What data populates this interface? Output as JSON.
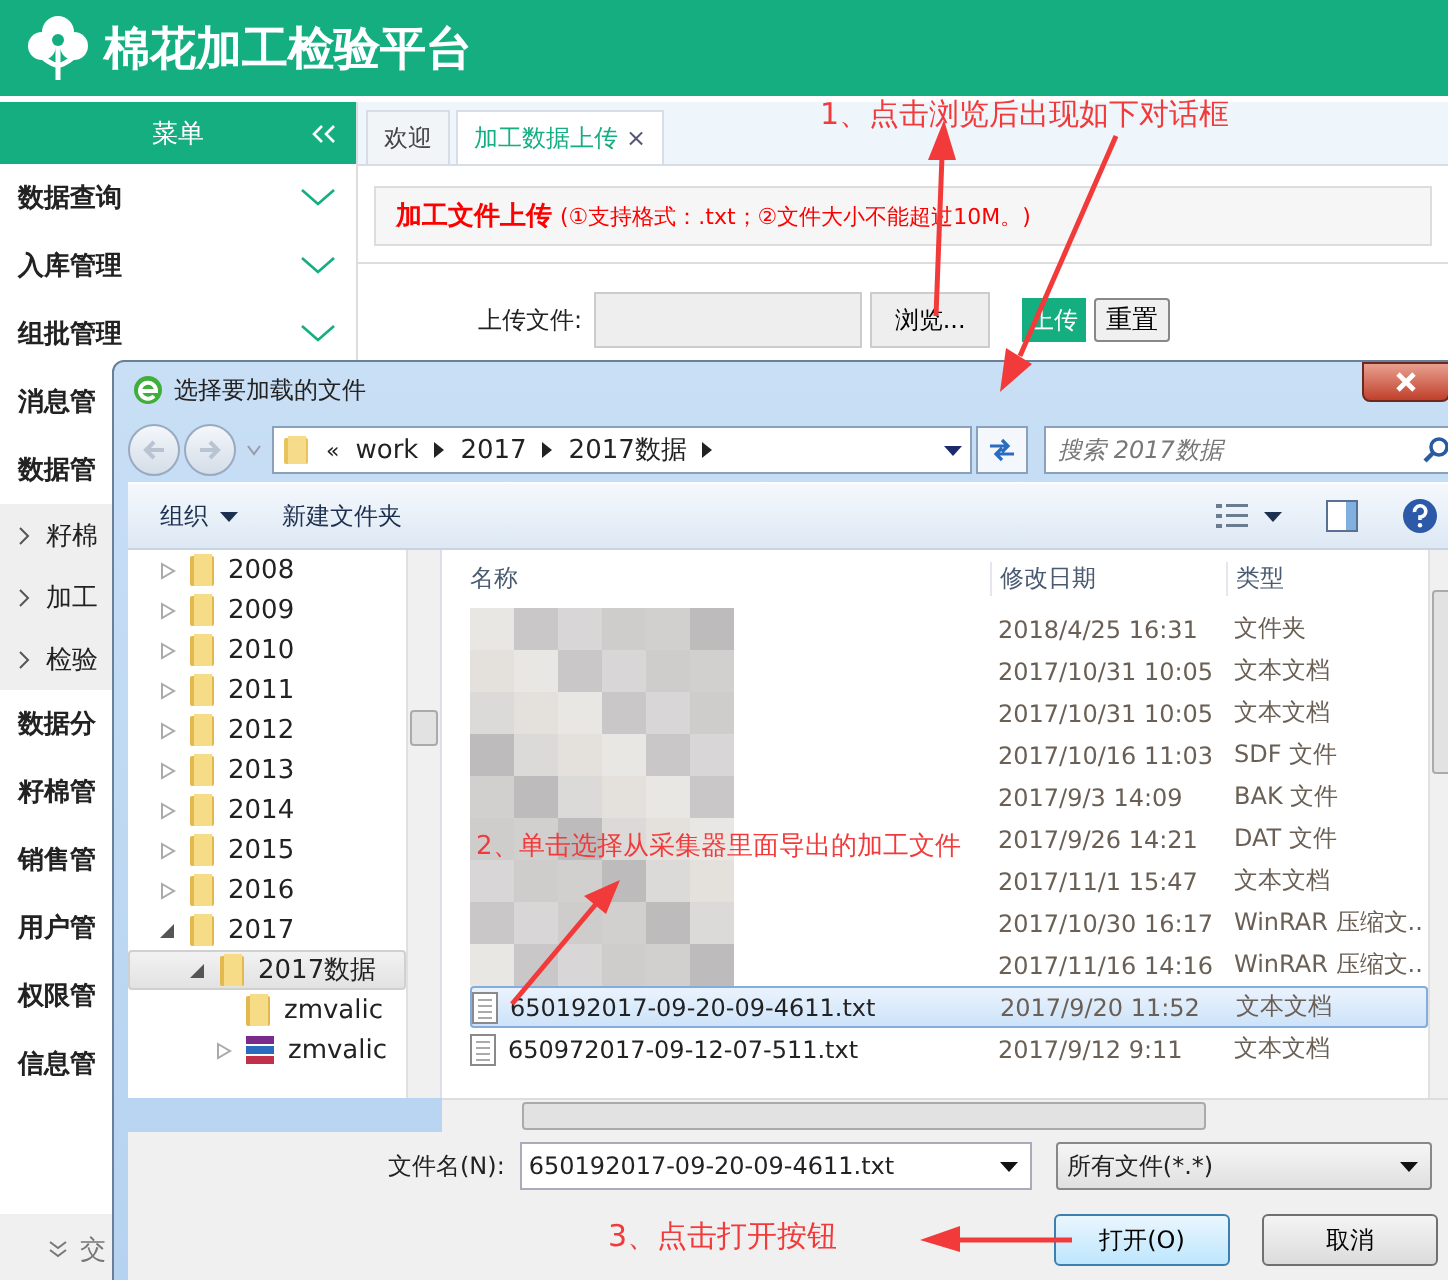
{
  "app": {
    "title": "棉花加工检验平台"
  },
  "sidebar": {
    "title": "菜单",
    "items": [
      {
        "label": "数据查询",
        "kind": "group",
        "chevron": true
      },
      {
        "label": "入库管理",
        "kind": "group",
        "chevron": true
      },
      {
        "label": "组批管理",
        "kind": "group",
        "chevron": true
      },
      {
        "label": "消息管",
        "kind": "group",
        "chevron": false
      },
      {
        "label": "数据管",
        "kind": "group",
        "chevron": false
      },
      {
        "label": "籽棉",
        "kind": "sub",
        "chevron": false
      },
      {
        "label": "加工",
        "kind": "sub",
        "chevron": false
      },
      {
        "label": "检验",
        "kind": "sub",
        "chevron": false
      },
      {
        "label": "数据分",
        "kind": "group",
        "chevron": false
      },
      {
        "label": "籽棉管",
        "kind": "group",
        "chevron": false
      },
      {
        "label": "销售管",
        "kind": "group",
        "chevron": false
      },
      {
        "label": "用户管",
        "kind": "group",
        "chevron": false
      },
      {
        "label": "权限管",
        "kind": "group",
        "chevron": false
      },
      {
        "label": "信息管",
        "kind": "group",
        "chevron": false
      }
    ],
    "footer": "交"
  },
  "tabs": [
    {
      "label": "欢迎",
      "selected": false
    },
    {
      "label": "加工数据上传",
      "selected": true,
      "close": "×"
    }
  ],
  "notice": {
    "title": "加工文件上传",
    "text": "(①支持格式：.txt；②文件大小不能超过10M。)"
  },
  "upload": {
    "label": "上传文件:",
    "browse": "浏览...",
    "upload": "上传",
    "reset": "重置"
  },
  "dialog": {
    "title": "选择要加载的文件",
    "breadcrumb_prefix": "«",
    "breadcrumb": [
      "work",
      "2017",
      "2017数据"
    ],
    "search_placeholder": "搜索 2017数据",
    "toolbar": [
      {
        "label": "组织",
        "kind": "menu"
      },
      {
        "label": "新建文件夹",
        "kind": "plain"
      }
    ],
    "tree": [
      {
        "label": "2008",
        "kind": "folder",
        "expanded": false,
        "selected": false
      },
      {
        "label": "2009",
        "kind": "folder",
        "expanded": false,
        "selected": false
      },
      {
        "label": "2010",
        "kind": "folder",
        "expanded": false,
        "selected": false
      },
      {
        "label": "2011",
        "kind": "folder",
        "expanded": false,
        "selected": false
      },
      {
        "label": "2012",
        "kind": "folder",
        "expanded": false,
        "selected": false
      },
      {
        "label": "2013",
        "kind": "folder",
        "expanded": false,
        "selected": false
      },
      {
        "label": "2014",
        "kind": "folder",
        "expanded": false,
        "selected": false
      },
      {
        "label": "2015",
        "kind": "folder",
        "expanded": false,
        "selected": false
      },
      {
        "label": "2016",
        "kind": "folder",
        "expanded": false,
        "selected": false
      },
      {
        "label": "2017",
        "kind": "folder",
        "expanded": true,
        "selected": false,
        "children": [
          {
            "label": "2017数据",
            "kind": "folder",
            "expanded": true,
            "selected": true,
            "children": [
              {
                "label": "zmvalic",
                "kind": "folder",
                "selected": false
              },
              {
                "label": "zmvalic",
                "kind": "archive",
                "expanded": false,
                "selected": false
              }
            ]
          }
        ]
      }
    ],
    "columns": [
      "名称",
      "修改日期",
      "类型"
    ],
    "files": [
      {
        "blurred": true,
        "date": "2018/4/25 16:31",
        "type": "文件夹",
        "selected": false
      },
      {
        "blurred": true,
        "date": "2017/10/31 10:05",
        "type": "文本文档",
        "selected": false
      },
      {
        "blurred": true,
        "date": "2017/10/31 10:05",
        "type": "文本文档",
        "selected": false
      },
      {
        "blurred": true,
        "date": "2017/10/16 11:03",
        "type": "SDF 文件",
        "selected": false
      },
      {
        "blurred": true,
        "date": "2017/9/3 14:09",
        "type": "BAK 文件",
        "selected": false
      },
      {
        "blurred": true,
        "date": "2017/9/26 14:21",
        "type": "DAT 文件",
        "selected": false
      },
      {
        "blurred": true,
        "date": "2017/11/1 15:47",
        "type": "文本文档",
        "selected": false
      },
      {
        "blurred": true,
        "date": "2017/10/30 16:17",
        "type": "WinRAR 压缩文..",
        "selected": false
      },
      {
        "blurred": true,
        "date": "2017/11/16 14:16",
        "type": "WinRAR 压缩文..",
        "selected": false
      },
      {
        "blurred": false,
        "name": "650192017-09-20-09-4611.txt",
        "date": "2017/9/20 11:52",
        "type": "文本文档",
        "selected": true
      },
      {
        "blurred": false,
        "name": "650972017-09-12-07-511.txt",
        "date": "2017/9/12 9:11",
        "type": "文本文档",
        "selected": false
      }
    ],
    "filename_label": "文件名(N):",
    "filename": "650192017-09-20-09-4611.txt",
    "filter": "所有文件(*.*)",
    "buttons": [
      {
        "label": "打开(O)",
        "kind": "primary"
      },
      {
        "label": "取消",
        "kind": "normal"
      }
    ]
  },
  "annotations": [
    {
      "text": "1、点击浏览后出现如下对话框"
    },
    {
      "text": "2、单击选择从采集器里面导出的加工文件"
    },
    {
      "text": "3、点击打开按钮"
    }
  ]
}
